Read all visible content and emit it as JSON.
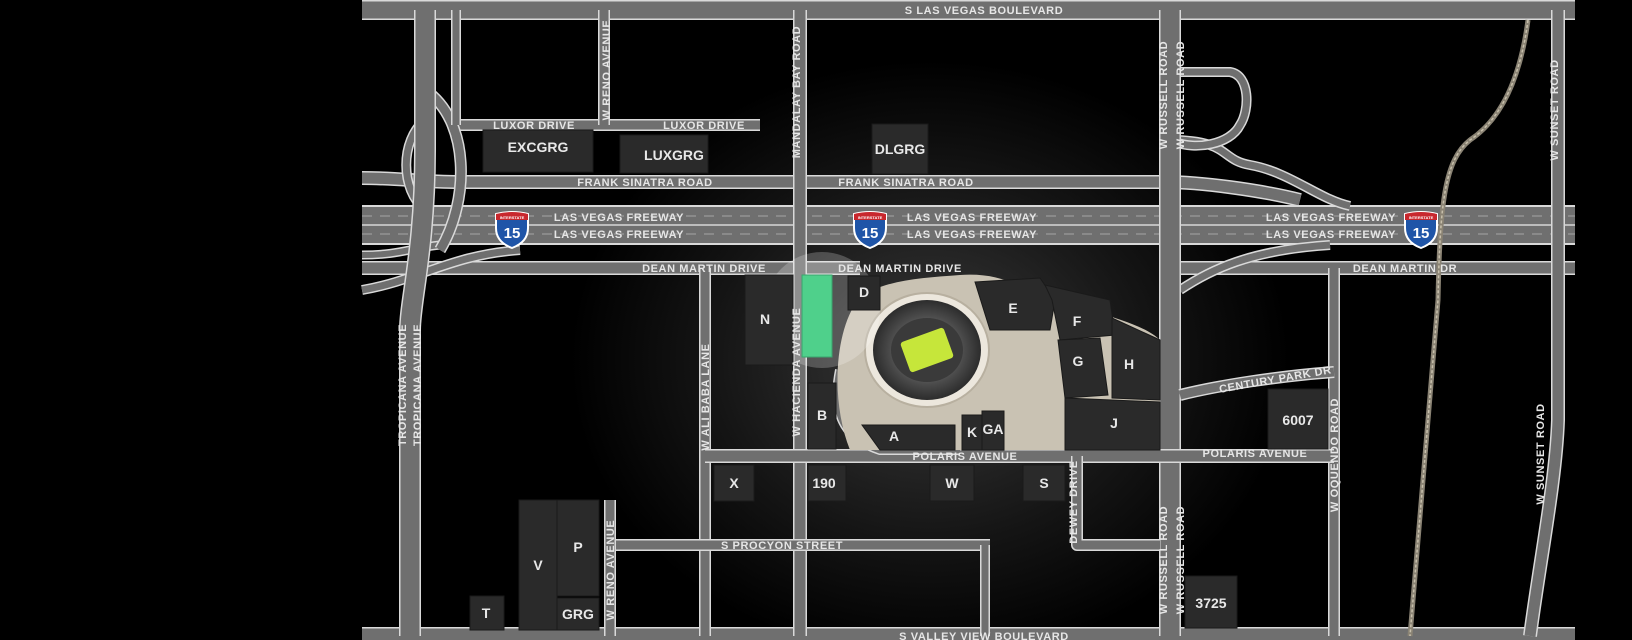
{
  "roads": {
    "s_las_vegas_blvd": "S LAS VEGAS BOULEVARD",
    "luxor_drive": "LUXOR DRIVE",
    "frank_sinatra_road": "FRANK SINATRA ROAD",
    "las_vegas_freeway": "LAS VEGAS FREEWAY",
    "dean_martin_drive": "DEAN MARTIN DRIVE",
    "dean_martin_dr": "DEAN MARTIN DR",
    "w_reno_avenue": "W RENO AVENUE",
    "mandalay_bay_road": "MANDALAY BAY ROAD",
    "w_russell_road": "W RUSSELL ROAD",
    "w_sunset_road": "W SUNSET ROAD",
    "tropicana_avenue": "TROPICANA AVENUE",
    "w_ali_baba_lane": "W ALI BABA LANE",
    "w_hacienda_avenue": "W HACIENDA AVENUE",
    "century_park_dr": "CENTURY PARK DR",
    "polaris_avenue": "POLARIS AVENUE",
    "w_oquendo_road": "W OQUENDO ROAD",
    "s_procyon_street": "S PROCYON STREET",
    "dewey_drive": "DEWEY DRIVE",
    "s_valley_view_blvd": "S VALLEY VIEW BOULEVARD"
  },
  "interstate": {
    "number": "15",
    "banner": "INTERSTATE"
  },
  "lots": {
    "excgrg": "EXCGRG",
    "luxgrg": "LUXGRG",
    "dlgrg": "DLGRG",
    "n": "N",
    "d": "D",
    "e": "E",
    "f": "F",
    "g": "G",
    "h": "H",
    "j": "J",
    "b": "B",
    "a": "A",
    "k": "K",
    "ga": "GA",
    "x": "X",
    "l190": "190",
    "w": "W",
    "s": "S",
    "l6007": "6007",
    "p": "P",
    "v": "V",
    "grg": "GRG",
    "t": "T",
    "l3725": "3725"
  },
  "colors": {
    "background": "#000000",
    "road": "#6f6f6f",
    "lot": "#2a2a2a",
    "plaza": "#c9c2b3",
    "highlight": "#4fd08b",
    "field": "#c6e63a"
  }
}
